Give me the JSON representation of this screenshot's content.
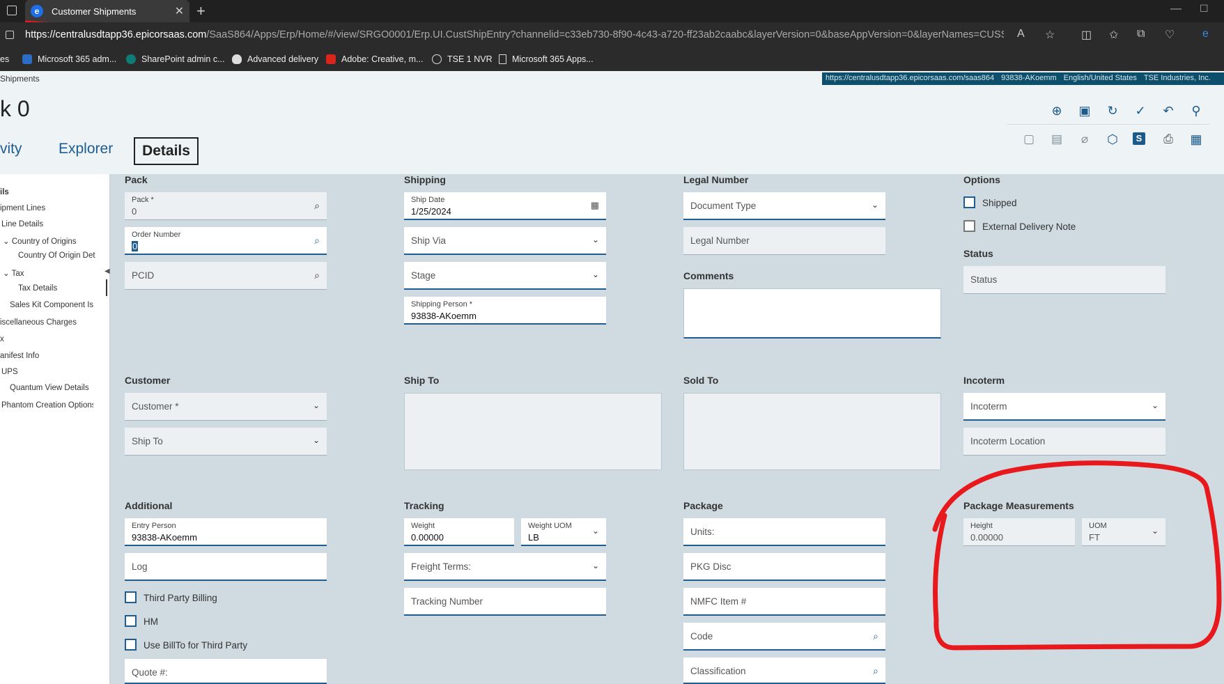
{
  "browser": {
    "tab_title": "Customer Shipments",
    "url_host": "https://centralusdtapp36.epicorsaas.com",
    "url_path": "/SaaS864/Apps/Erp/Home/#/view/SRGO0001/Erp.UI.CustShipEntry?channelid=c33eb730-8f90-4c43-a720-ff23ab2caabc&layerVersion=0&baseAppVersion=0&layerNames=CUSShipEntry...",
    "bookmarks": [
      "es",
      "Microsoft 365 adm...",
      "SharePoint admin c...",
      "Advanced delivery",
      "Adobe: Creative, m...",
      "TSE 1 NVR",
      "Microsoft 365 Apps..."
    ]
  },
  "app": {
    "breadcrumb": "Shipments",
    "info_url": "https://centralusdtapp36.epicorsaas.com/saas864",
    "info_user": "93838-AKoemm",
    "info_locale": "English/United States",
    "info_company": "TSE Industries, Inc.",
    "title": "k 0",
    "tabs": {
      "activity": "vity",
      "explorer": "Explorer",
      "details": "Details"
    }
  },
  "sidebar": {
    "items": [
      "ils",
      "ipment Lines",
      "Line Details",
      "Country of Origins",
      "Country Of Origin Det",
      "Tax",
      "Tax Details",
      "Sales Kit Component Iss",
      "iscellaneous Charges",
      "x",
      "anifest Info",
      "UPS",
      "Quantum View Details",
      "Phantom Creation Options"
    ]
  },
  "pack": {
    "heading": "Pack",
    "pack_label": "Pack *",
    "pack_value": "0",
    "order_label": "Order Number",
    "order_value": "0",
    "pcid": "PCID"
  },
  "shipping": {
    "heading": "Shipping",
    "ship_date_label": "Ship Date",
    "ship_date_value": "1/25/2024",
    "ship_via": "Ship Via",
    "stage": "Stage",
    "person_label": "Shipping Person *",
    "person_value": "93838-AKoemm"
  },
  "legal": {
    "heading": "Legal Number",
    "doc_type": "Document Type",
    "legal_number": "Legal Number",
    "comments_heading": "Comments"
  },
  "options": {
    "heading": "Options",
    "shipped": "Shipped",
    "external": "External Delivery Note",
    "status_heading": "Status",
    "status": "Status"
  },
  "customer": {
    "heading": "Customer",
    "customer": "Customer *",
    "ship_to": "Ship To",
    "ship_to_heading": "Ship To",
    "sold_to_heading": "Sold To"
  },
  "incoterm": {
    "heading": "Incoterm",
    "incoterm": "Incoterm",
    "location": "Incoterm Location"
  },
  "additional": {
    "heading": "Additional",
    "entry_label": "Entry Person",
    "entry_value": "93838-AKoemm",
    "log": "Log",
    "third_party": "Third Party Billing",
    "hm": "HM",
    "billto": "Use BillTo for Third Party",
    "quote": "Quote #:"
  },
  "tracking": {
    "heading": "Tracking",
    "weight_label": "Weight",
    "weight_value": "0.00000",
    "uom_label": "Weight UOM",
    "uom_value": "LB",
    "freight": "Freight Terms:",
    "tracking_number": "Tracking Number"
  },
  "package": {
    "heading": "Package",
    "units": "Units:",
    "pkg_disc": "PKG Disc",
    "nmfc": "NMFC Item #",
    "code": "Code",
    "classification": "Classification"
  },
  "measurements": {
    "heading": "Package Measurements",
    "height_label": "Height",
    "height_value": "0.00000",
    "uom_label": "UOM",
    "uom_value": "FT"
  },
  "colors": {
    "accent": "#1f5c8f",
    "annotation": "#e8191c",
    "info_strip": "#0d4f6b"
  }
}
